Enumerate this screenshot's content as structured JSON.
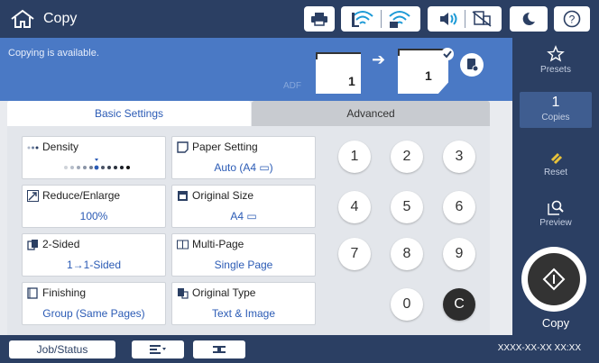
{
  "header": {
    "title": "Copy",
    "toolbar_icons": [
      "printer-icon",
      "wifi-icon",
      "wifi-direct-icon",
      "volume-icon",
      "fax-off-icon",
      "sleep-icon",
      "help-icon"
    ],
    "toolbar_icon_help_glyph": "?"
  },
  "status": {
    "message": "Copying is available.",
    "adf_label": "ADF",
    "original_count": "1",
    "output_count": "1"
  },
  "tabs": {
    "basic": "Basic Settings",
    "advanced": "Advanced"
  },
  "settings": {
    "density": {
      "label": "Density",
      "value": ""
    },
    "paper_setting": {
      "label": "Paper Setting",
      "value": "Auto (A4 ▭)"
    },
    "reduce_enlarge": {
      "label": "Reduce/Enlarge",
      "value": "100%"
    },
    "original_size": {
      "label": "Original Size",
      "value": "A4 ▭"
    },
    "two_sided": {
      "label": "2-Sided",
      "value": "1→1-Sided"
    },
    "multi_page": {
      "label": "Multi-Page",
      "value": "Single Page"
    },
    "finishing": {
      "label": "Finishing",
      "value": "Group (Same Pages)"
    },
    "original_type": {
      "label": "Original Type",
      "value": "Text & Image"
    }
  },
  "keypad": {
    "keys": [
      "1",
      "2",
      "3",
      "4",
      "5",
      "6",
      "7",
      "8",
      "9",
      "0",
      "C"
    ]
  },
  "side_panel": {
    "presets": "Presets",
    "copies_count": "1",
    "copies_label": "Copies",
    "reset": "Reset",
    "preview": "Preview",
    "copy": "Copy"
  },
  "footer": {
    "job_status": "Job/Status",
    "datetime": "XXXX-XX-XX XX:XX"
  },
  "colors": {
    "dark_navy": "#2b3f63",
    "status_blue": "#4a79c5",
    "accent_blue": "#2b5bb5",
    "reset_yellow": "#e8c23a"
  }
}
